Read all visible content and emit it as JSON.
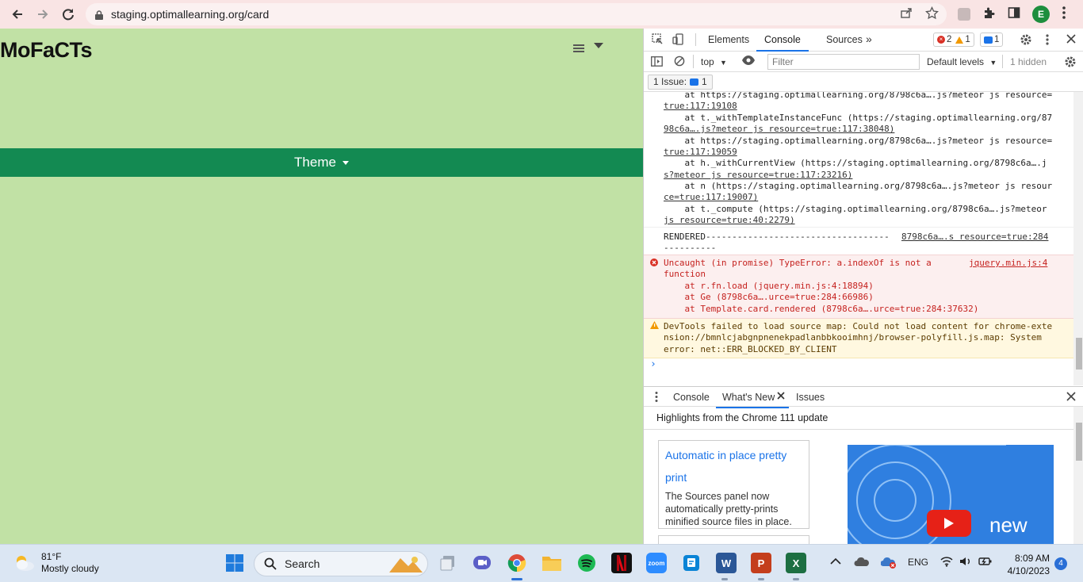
{
  "browser": {
    "url": "staging.optimallearning.org/card",
    "profile_initial": "E"
  },
  "page": {
    "logo": "MoFaCTs",
    "theme_label": "Theme"
  },
  "devtools": {
    "tabs": [
      "Elements",
      "Console",
      "Sources"
    ],
    "more_tabs": "»",
    "error_count": "2",
    "warning_count": "1",
    "message_count": "1",
    "context": "top",
    "filter_placeholder": "Filter",
    "levels": "Default levels",
    "hidden": "1 hidden",
    "issues_label": "1 Issue:",
    "issues_count": "1",
    "console_lines": [
      "    at https://staging.optimallearning.org/8798c6a….js?meteor js resource=",
      "true:117:19108",
      "    at t._withTemplateInstanceFunc (https://staging.optimallearning.org/87",
      "98c6a….js?meteor js resource=true:117:38048)",
      "    at https://staging.optimallearning.org/8798c6a….js?meteor js resource=",
      "true:117:19059",
      "    at h._withCurrentView (https://staging.optimallearning.org/8798c6a….j",
      "s?meteor js resource=true:117:23216)",
      "    at n (https://staging.optimallearning.org/8798c6a….js?meteor js resour",
      "ce=true:117:19007)",
      "    at t._compute (https://staging.optimallearning.org/8798c6a….js?meteor ",
      "js resource=true:40:2279)"
    ],
    "rendered_line": "RENDERED-----------------------------------",
    "rendered_line2": "----------",
    "rendered_src": "8798c6a….s resource=true:284",
    "error": {
      "line1": "Uncaught (in promise) TypeError: a.indexOf is not a",
      "line2": "function",
      "src": "jquery.min.js:4",
      "stack": [
        "    at r.fn.load (jquery.min.js:4:18894)",
        "    at Ge (8798c6a….urce=true:284:66986)",
        "    at Template.card.rendered (8798c6a….urce=true:284:37632)"
      ]
    },
    "warning": {
      "line1": "DevTools failed to load source map: Could not load content for chrome-exte",
      "line2": "nsion://bmnlcjabgnpnenekpadlanbbkooimhnj/browser-polyfill.js.map: System",
      "line3": "error: net::ERR_BLOCKED_BY_CLIENT"
    },
    "prompt": "›",
    "drawer_tabs": [
      "Console",
      "What's New",
      "Issues"
    ],
    "whatsnew": {
      "heading": "Highlights from the Chrome 111 update",
      "card_title": "Automatic in place pretty print",
      "card_desc": "The Sources panel now automatically pretty-prints minified source files in place.",
      "video_word": "new"
    }
  },
  "taskbar": {
    "weather_temp": "81°F",
    "weather_desc": "Mostly cloudy",
    "search_label": "Search",
    "lang": "ENG",
    "time": "8:09 AM",
    "date": "4/10/2023",
    "notifications": "4"
  }
}
